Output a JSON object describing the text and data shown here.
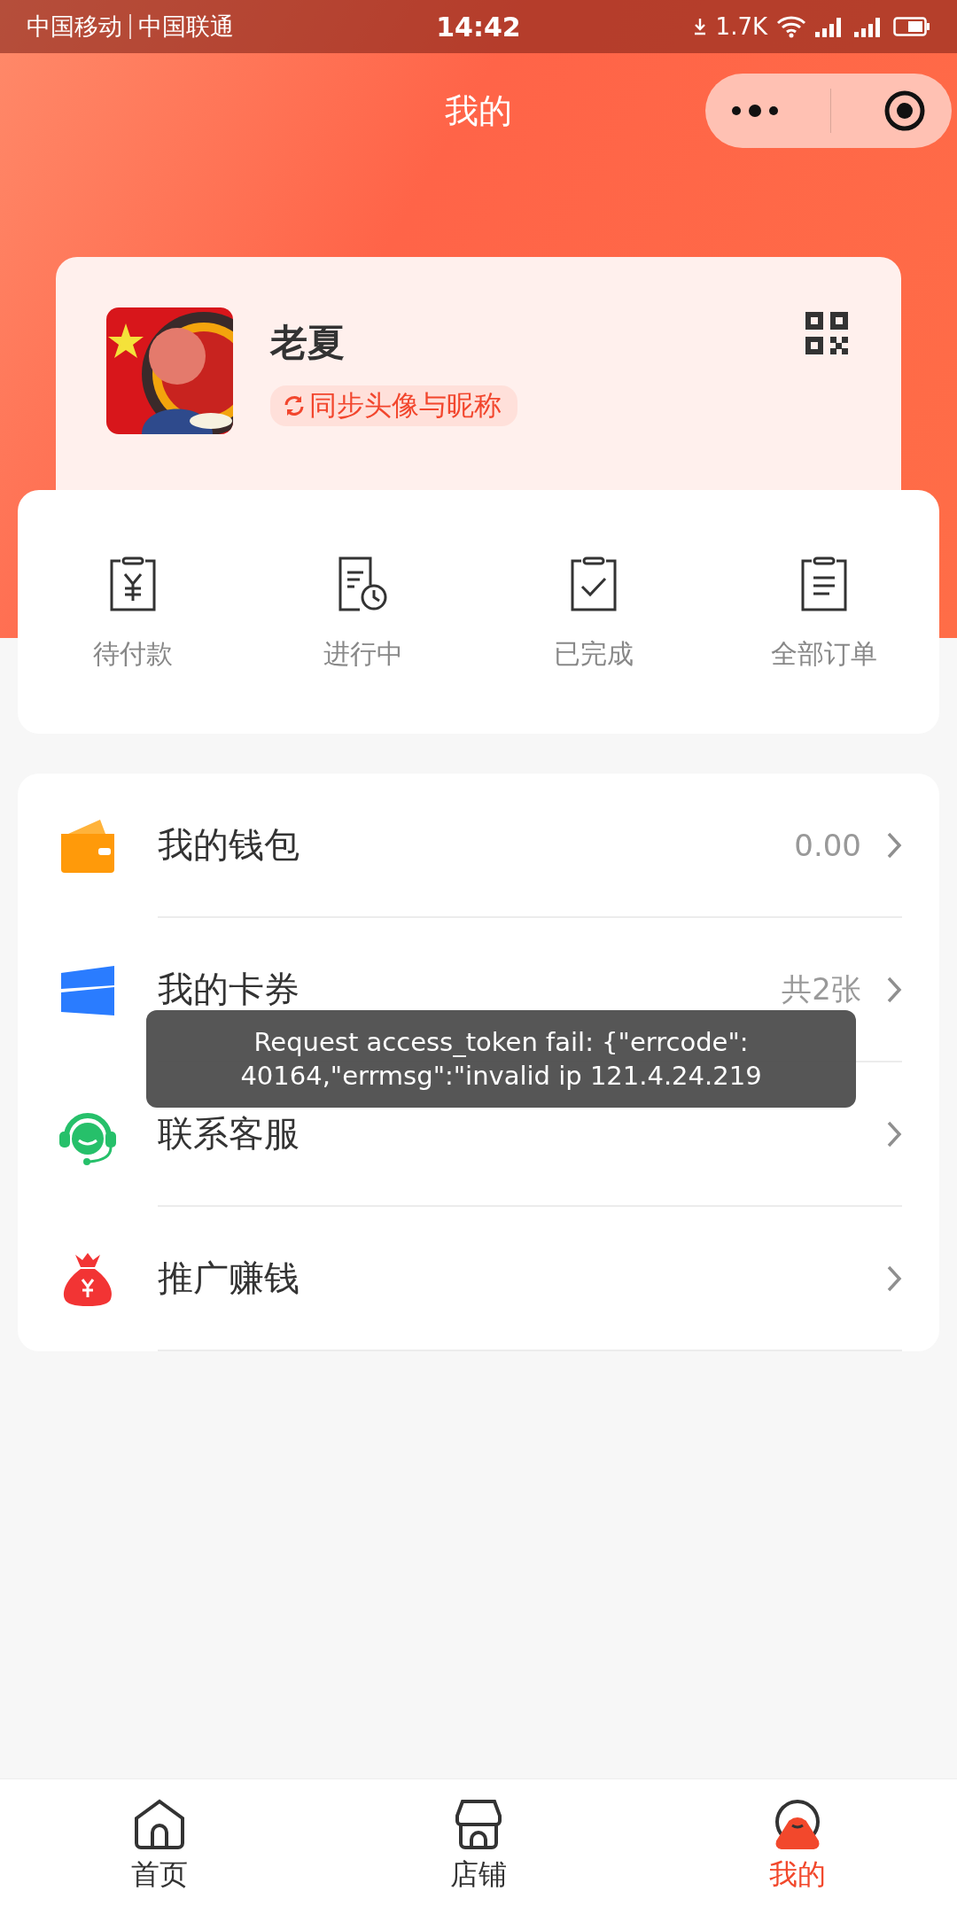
{
  "status_bar": {
    "carriers": [
      "中国移动",
      "中国联通"
    ],
    "time": "14:42",
    "net_speed": "1.7K"
  },
  "nav": {
    "title": "我的"
  },
  "profile": {
    "name": "老夏",
    "sync_label": "同步头像与昵称"
  },
  "orders": [
    {
      "label": "待付款",
      "kind": "pay"
    },
    {
      "label": "进行中",
      "kind": "progress"
    },
    {
      "label": "已完成",
      "kind": "done"
    },
    {
      "label": "全部订单",
      "kind": "all"
    }
  ],
  "menu": [
    {
      "label": "我的钱包",
      "kind": "wallet",
      "value": "0.00"
    },
    {
      "label": "我的卡券",
      "kind": "coupon",
      "value": "共2张"
    },
    {
      "label": "联系客服",
      "kind": "service"
    },
    {
      "label": "推广赚钱",
      "kind": "promote"
    }
  ],
  "toast": {
    "lines": [
      "Request access_token fail: {\"errcode\":",
      "40164,\"errmsg\":\"invalid ip 121.4.24.219"
    ]
  },
  "tab_bar": [
    {
      "label": "首页",
      "kind": "home",
      "selected": false
    },
    {
      "label": "店铺",
      "kind": "shop",
      "selected": false
    },
    {
      "label": "我的",
      "kind": "me",
      "selected": true
    }
  ]
}
